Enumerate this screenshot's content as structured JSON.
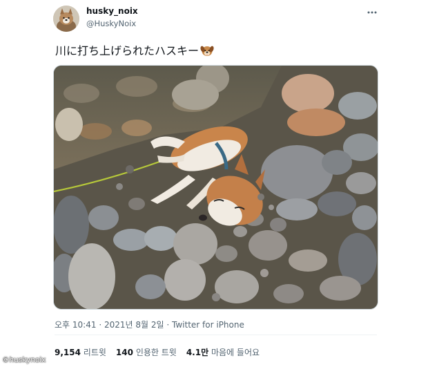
{
  "user": {
    "display_name": "husky_noix",
    "handle": "@HuskyNoix"
  },
  "tweet": {
    "text": "川に打ち上げられたハスキー",
    "emoji_icon": "dog-face-icon",
    "media_alt": "husky dog lying on riverside stones"
  },
  "meta": {
    "time": "오후 10:41",
    "separator": "·",
    "date": "2021년 8월 2일",
    "app": "Twitter for iPhone"
  },
  "stats": {
    "retweets_count": "9,154",
    "retweets_label": "리트윗",
    "quotes_count": "140",
    "quotes_label": "인용한 트윗",
    "likes_count": "4.1만",
    "likes_label": "마음에 들어요"
  },
  "watermark": "©huskynoix",
  "colors": {
    "primary_text": "#0f1419",
    "secondary_text": "#536471",
    "border": "#cfd9de"
  }
}
